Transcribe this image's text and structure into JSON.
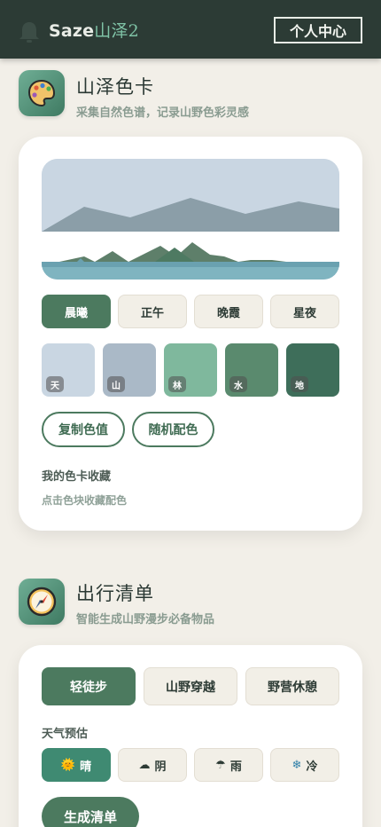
{
  "header": {
    "brand_prefix": "Saze",
    "brand_accent": "山泽2",
    "profile_button": "个人中心"
  },
  "palette_section": {
    "title": "山泽色卡",
    "subtitle": "采集自然色谱，记录山野色彩灵感",
    "icon": "palette-icon",
    "times": [
      {
        "label": "晨曦",
        "active": true
      },
      {
        "label": "正午",
        "active": false
      },
      {
        "label": "晚霞",
        "active": false
      },
      {
        "label": "星夜",
        "active": false
      }
    ],
    "swatches": [
      {
        "tag": "天",
        "color": "#c9d6e2"
      },
      {
        "tag": "山",
        "color": "#aab9c7"
      },
      {
        "tag": "林",
        "color": "#7fb89d"
      },
      {
        "tag": "水",
        "color": "#5a8a6e"
      },
      {
        "tag": "地",
        "color": "#3e6e5a"
      }
    ],
    "copy_button": "复制色值",
    "random_button": "随机配色",
    "collection_title": "我的色卡收藏",
    "collection_hint": "点击色块收藏配色"
  },
  "checklist_section": {
    "title": "出行清单",
    "subtitle": "智能生成山野漫步必备物品",
    "icon": "compass-icon",
    "activities": [
      {
        "label": "轻徒步",
        "active": true
      },
      {
        "label": "山野穿越",
        "active": false
      },
      {
        "label": "野营休憩",
        "active": false
      }
    ],
    "weather_label": "天气预估",
    "weather": [
      {
        "icon": "sun-icon",
        "glyph": "🌞",
        "label": "晴",
        "active": true
      },
      {
        "icon": "cloud-icon",
        "glyph": "☁",
        "label": "阴",
        "active": false
      },
      {
        "icon": "rain-icon",
        "glyph": "☂",
        "label": "雨",
        "active": false
      },
      {
        "icon": "snowflake-icon",
        "glyph": "❄",
        "label": "冷",
        "active": false
      }
    ],
    "generate_button": "生成清单"
  },
  "colors": {
    "header_bg": "#2c3b35",
    "accent": "#4c7a5f",
    "weather_active": "#3f8a72",
    "page_bg": "#f2efe8"
  }
}
